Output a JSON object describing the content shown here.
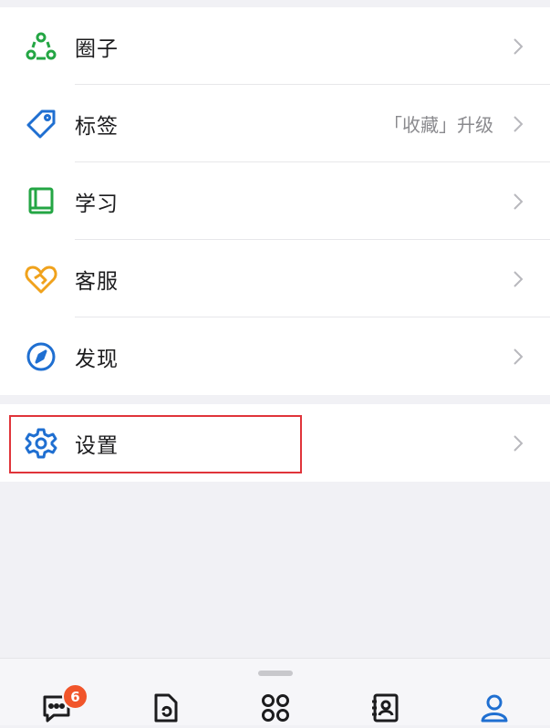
{
  "menu": [
    {
      "id": "circle",
      "label": "圈子",
      "extra": "",
      "icon": "circle-people-icon",
      "color": "#24a644"
    },
    {
      "id": "tags",
      "label": "标签",
      "extra": "「收藏」升级",
      "icon": "tag-icon",
      "color": "#1f6fd1"
    },
    {
      "id": "study",
      "label": "学习",
      "extra": "",
      "icon": "book-icon",
      "color": "#24a644"
    },
    {
      "id": "service",
      "label": "客服",
      "extra": "",
      "icon": "heart-handshake-icon",
      "color": "#f0a21c"
    },
    {
      "id": "discover",
      "label": "发现",
      "extra": "",
      "icon": "compass-icon",
      "color": "#1f6fd1"
    }
  ],
  "settings": {
    "label": "设置",
    "icon": "gear-icon",
    "color": "#1f6fd1"
  },
  "tabbar": {
    "messages_badge": "6",
    "tabs": [
      {
        "id": "messages",
        "icon": "chat-icon"
      },
      {
        "id": "docs",
        "icon": "document-icon"
      },
      {
        "id": "workbench",
        "icon": "apps-icon"
      },
      {
        "id": "contacts",
        "icon": "contacts-icon"
      },
      {
        "id": "me",
        "icon": "person-icon"
      }
    ],
    "active_color": "#1f6fd1"
  }
}
